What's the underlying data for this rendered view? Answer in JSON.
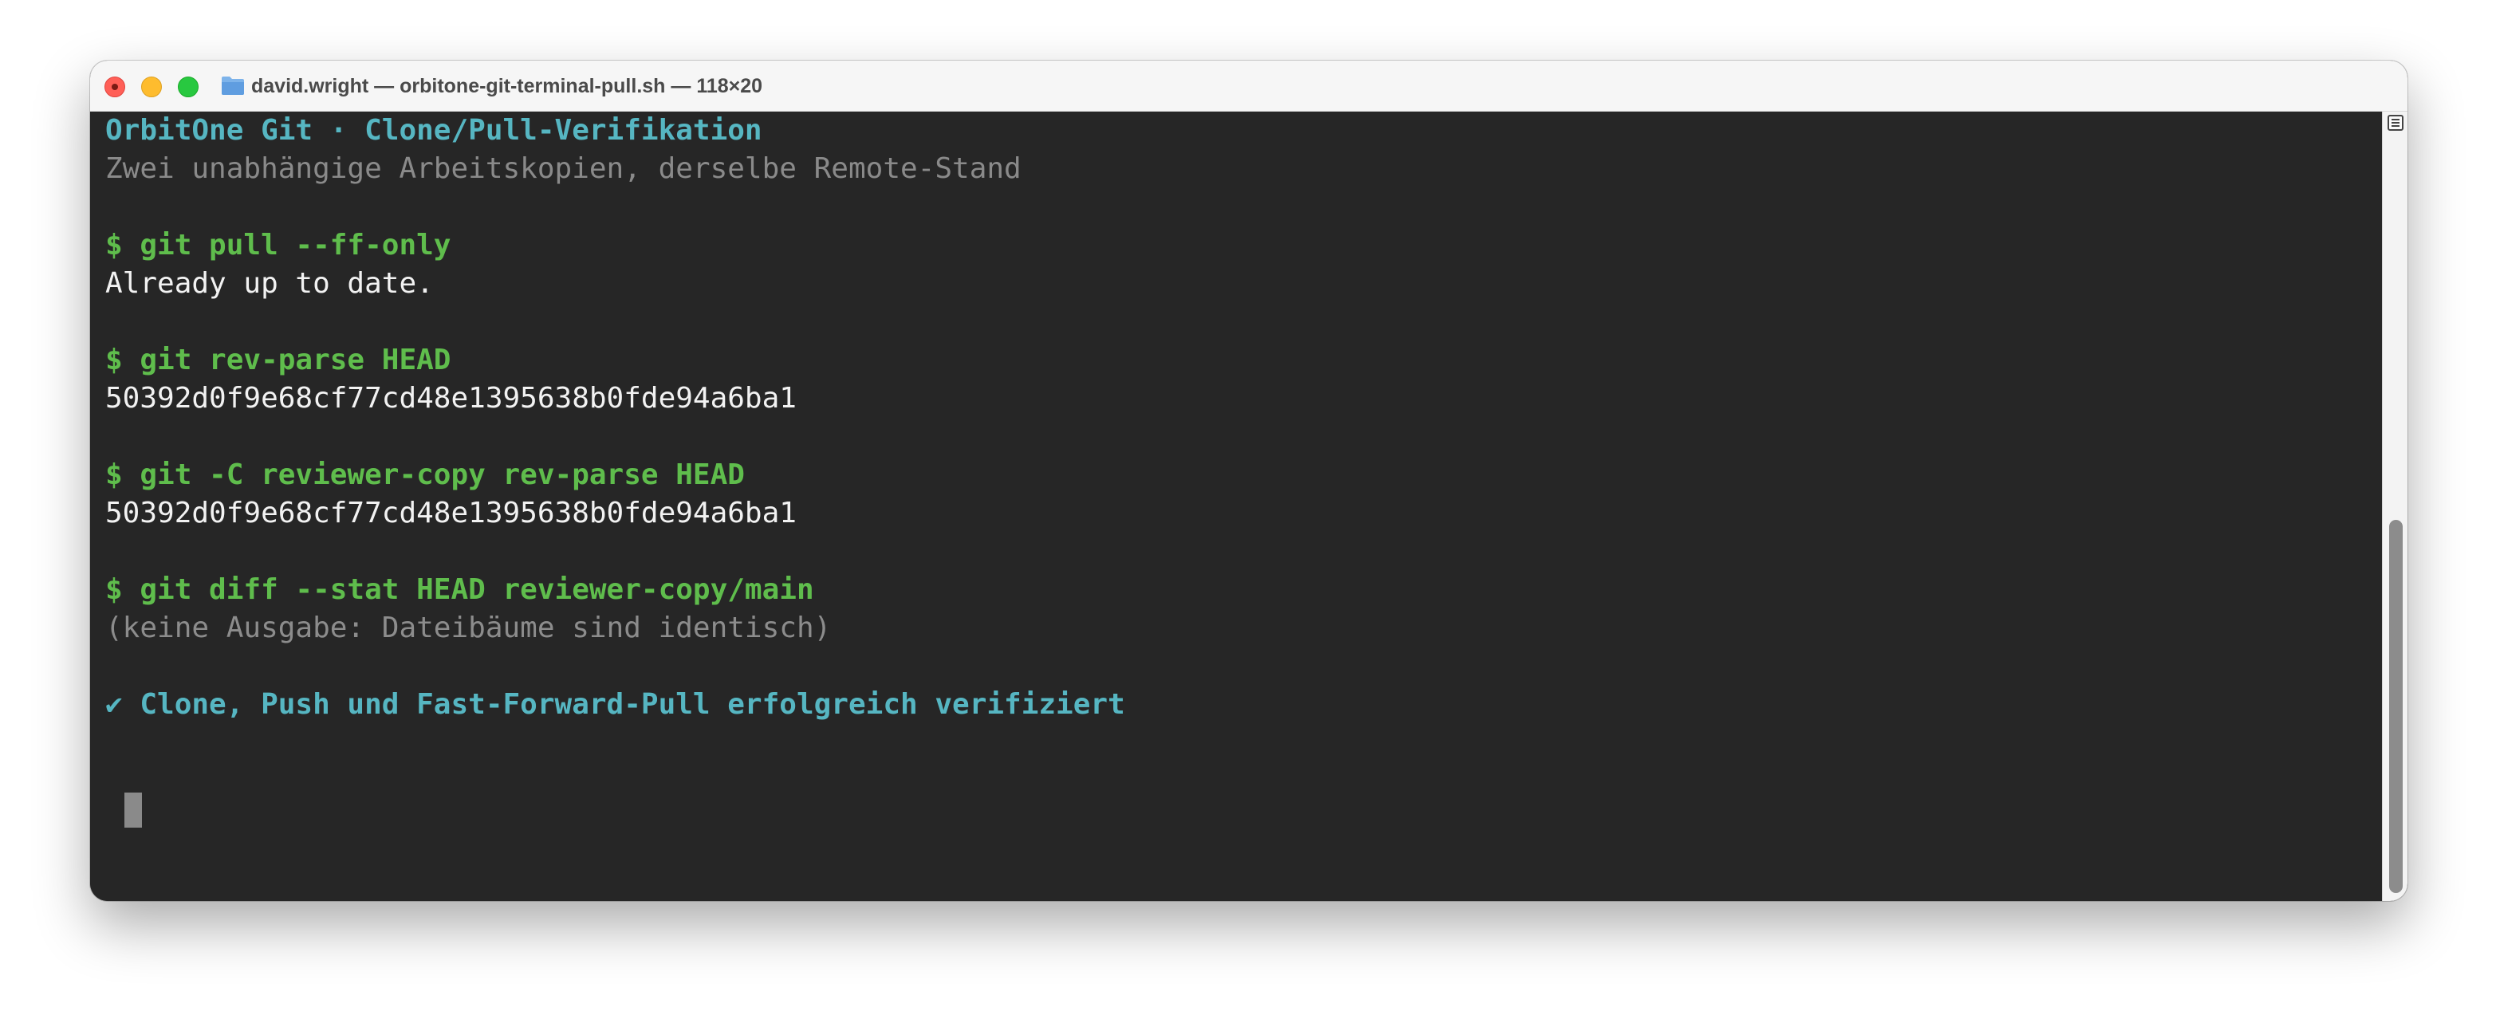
{
  "window": {
    "title": "david.wright — orbitone-git-terminal-pull.sh — 118×20"
  },
  "icons": {
    "traffic_lights": [
      "close-icon",
      "minimize-icon",
      "zoom-icon"
    ],
    "title": "folder-icon",
    "scrollbar": "scrollbar-menu-icon"
  },
  "colors": {
    "title": "#56b6c2",
    "subtitle": "#8a8a8a",
    "command": "#5fbd4c",
    "output": "#f2f2f2",
    "dim": "#8c8c8c",
    "success": "#56b6c2",
    "background": "#262626"
  },
  "terminal": {
    "heading": "OrbitOne Git · Clone/Pull-Verifikation",
    "subheading": "Zwei unabhängige Arbeitskopien, derselbe Remote-Stand",
    "blocks": [
      {
        "command": "$ git pull --ff-only",
        "output": "Already up to date."
      },
      {
        "command": "$ git rev-parse HEAD",
        "output": "50392d0f9e68cf77cd48e1395638b0fde94a6ba1"
      },
      {
        "command": "$ git -C reviewer-copy rev-parse HEAD",
        "output": "50392d0f9e68cf77cd48e1395638b0fde94a6ba1"
      },
      {
        "command": "$ git diff --stat HEAD reviewer-copy/main",
        "output": "(keine Ausgabe: Dateibäume sind identisch)"
      }
    ],
    "success": "✔ Clone, Push und Fast-Forward-Pull erfolgreich verifiziert"
  }
}
